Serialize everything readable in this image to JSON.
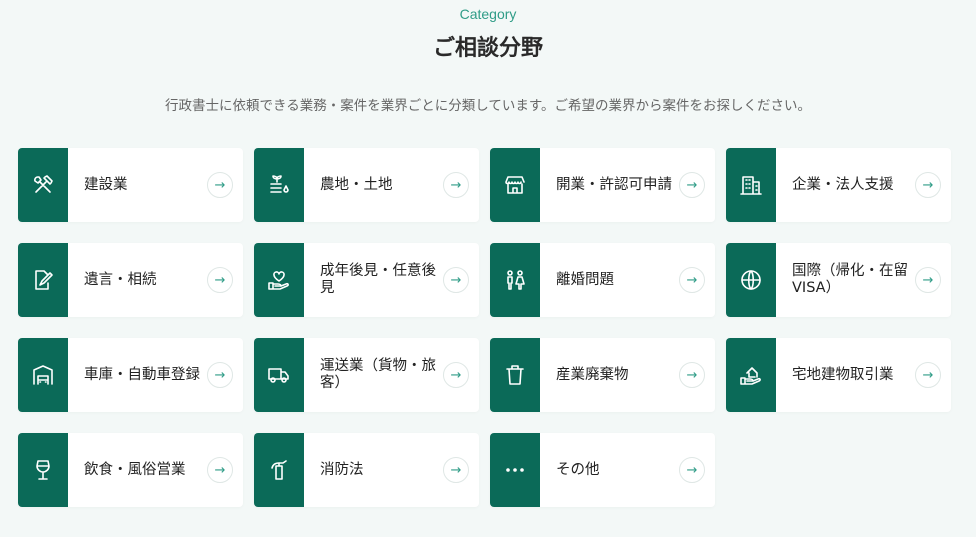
{
  "header": {
    "eyebrow": "Category",
    "title": "ご相談分野",
    "lead": "行政書士に依頼できる業務・案件を業界ごとに分類しています。ご希望の業界から案件をお探しください。"
  },
  "colors": {
    "accent": "#0b6a58",
    "eyebrow": "#2f9c87",
    "background": "#f3f8f7"
  },
  "arrow_glyph": "→",
  "categories": [
    {
      "label": "建設業",
      "icon": "tools-icon"
    },
    {
      "label": "農地・土地",
      "icon": "farmland-icon"
    },
    {
      "label": "開業・許認可申請",
      "icon": "store-icon"
    },
    {
      "label": "企業・法人支援",
      "icon": "building-icon"
    },
    {
      "label": "遺言・相続",
      "icon": "document-edit-icon"
    },
    {
      "label": "成年後見・任意後見",
      "icon": "hand-heart-icon"
    },
    {
      "label": "離婚問題",
      "icon": "couple-icon"
    },
    {
      "label": "国際（帰化・在留VISA）",
      "icon": "globe-icon"
    },
    {
      "label": "車庫・自動車登録",
      "icon": "garage-icon"
    },
    {
      "label": "運送業（貨物・旅客）",
      "icon": "truck-icon"
    },
    {
      "label": "産業廃棄物",
      "icon": "trash-icon"
    },
    {
      "label": "宅地建物取引業",
      "icon": "house-hand-icon"
    },
    {
      "label": "飲食・風俗営業",
      "icon": "wine-glass-icon"
    },
    {
      "label": "消防法",
      "icon": "fire-extinguisher-icon"
    },
    {
      "label": "その他",
      "icon": "more-icon"
    }
  ]
}
